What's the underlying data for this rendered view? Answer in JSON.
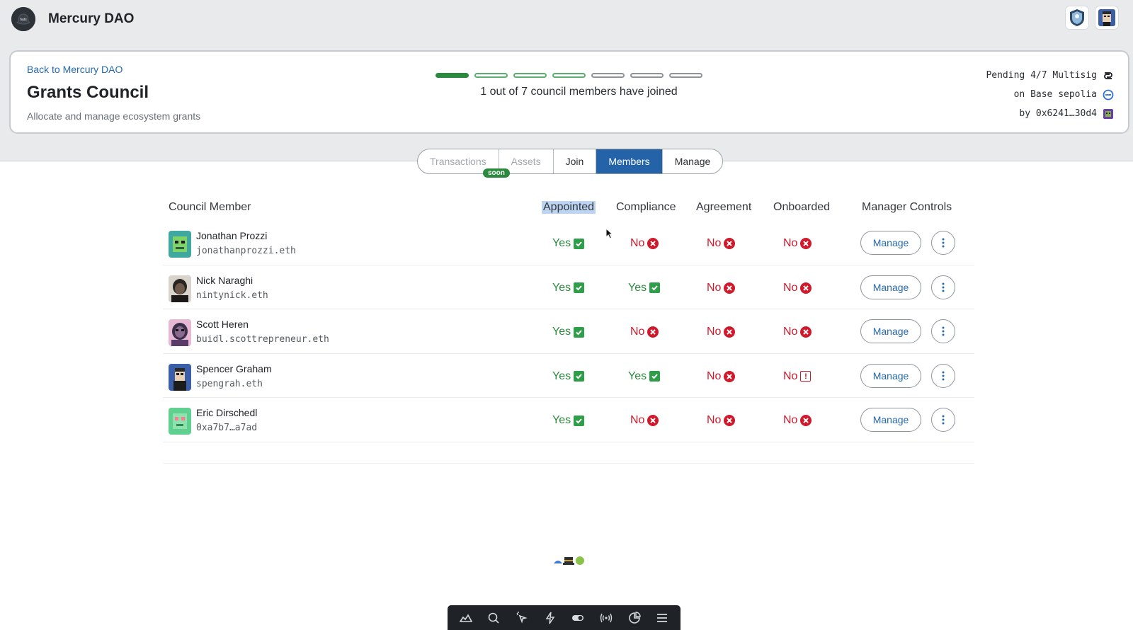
{
  "app": {
    "name": "Mercury DAO"
  },
  "header": {
    "back_link": "Back to Mercury DAO",
    "title": "Grants Council",
    "subtitle": "Allocate and manage ecosystem grants",
    "progress": {
      "joined": 1,
      "total": 7,
      "text": "1 out of 7 council members have joined"
    },
    "safe": {
      "status": "Pending 4/7 Multisig",
      "network": "on Base sepolia",
      "creator": "by 0x6241…30d4"
    }
  },
  "tabs": [
    {
      "label": "Transactions",
      "state": "disabled"
    },
    {
      "label": "Assets",
      "state": "disabled"
    },
    {
      "label": "Join",
      "state": "normal"
    },
    {
      "label": "Members",
      "state": "active"
    },
    {
      "label": "Manage",
      "state": "normal"
    }
  ],
  "soon_badge": "soon",
  "table": {
    "columns": {
      "member": "Council Member",
      "appointed": "Appointed",
      "compliance": "Compliance",
      "agreement": "Agreement",
      "onboarded": "Onboarded",
      "controls": "Manager Controls"
    },
    "rows": [
      {
        "name": "Jonathan Prozzi",
        "ens": "jonathanprozzi.eth",
        "appointed": "Yes",
        "compliance": "No",
        "agreement": "No",
        "onboarded": "No",
        "onboarded_icon": "x-circle-icon",
        "manage": "Manage"
      },
      {
        "name": "Nick Naraghi",
        "ens": "nintynick.eth",
        "appointed": "Yes",
        "compliance": "Yes",
        "agreement": "No",
        "onboarded": "No",
        "onboarded_icon": "x-circle-icon",
        "manage": "Manage"
      },
      {
        "name": "Scott Heren",
        "ens": "buidl.scottrepreneur.eth",
        "appointed": "Yes",
        "compliance": "No",
        "agreement": "No",
        "onboarded": "No",
        "onboarded_icon": "x-circle-icon",
        "manage": "Manage"
      },
      {
        "name": "Spencer Graham",
        "ens": "spengrah.eth",
        "appointed": "Yes",
        "compliance": "Yes",
        "agreement": "No",
        "onboarded": "No",
        "onboarded_icon": "warning-icon",
        "manage": "Manage"
      },
      {
        "name": "Eric Dirschedl",
        "ens": "0xa7b7…a7ad",
        "appointed": "Yes",
        "compliance": "No",
        "agreement": "No",
        "onboarded": "No",
        "onboarded_icon": "x-circle-icon",
        "manage": "Manage"
      }
    ]
  },
  "colors": {
    "accent": "#2463a8",
    "success": "#2b8a3e",
    "danger": "#d0192b"
  },
  "toolbar_icons": [
    "audit-icon",
    "search-icon",
    "inspect-icon",
    "lightning-icon",
    "toggle-icon",
    "broadcast-icon",
    "chart-icon",
    "menu-icon"
  ]
}
